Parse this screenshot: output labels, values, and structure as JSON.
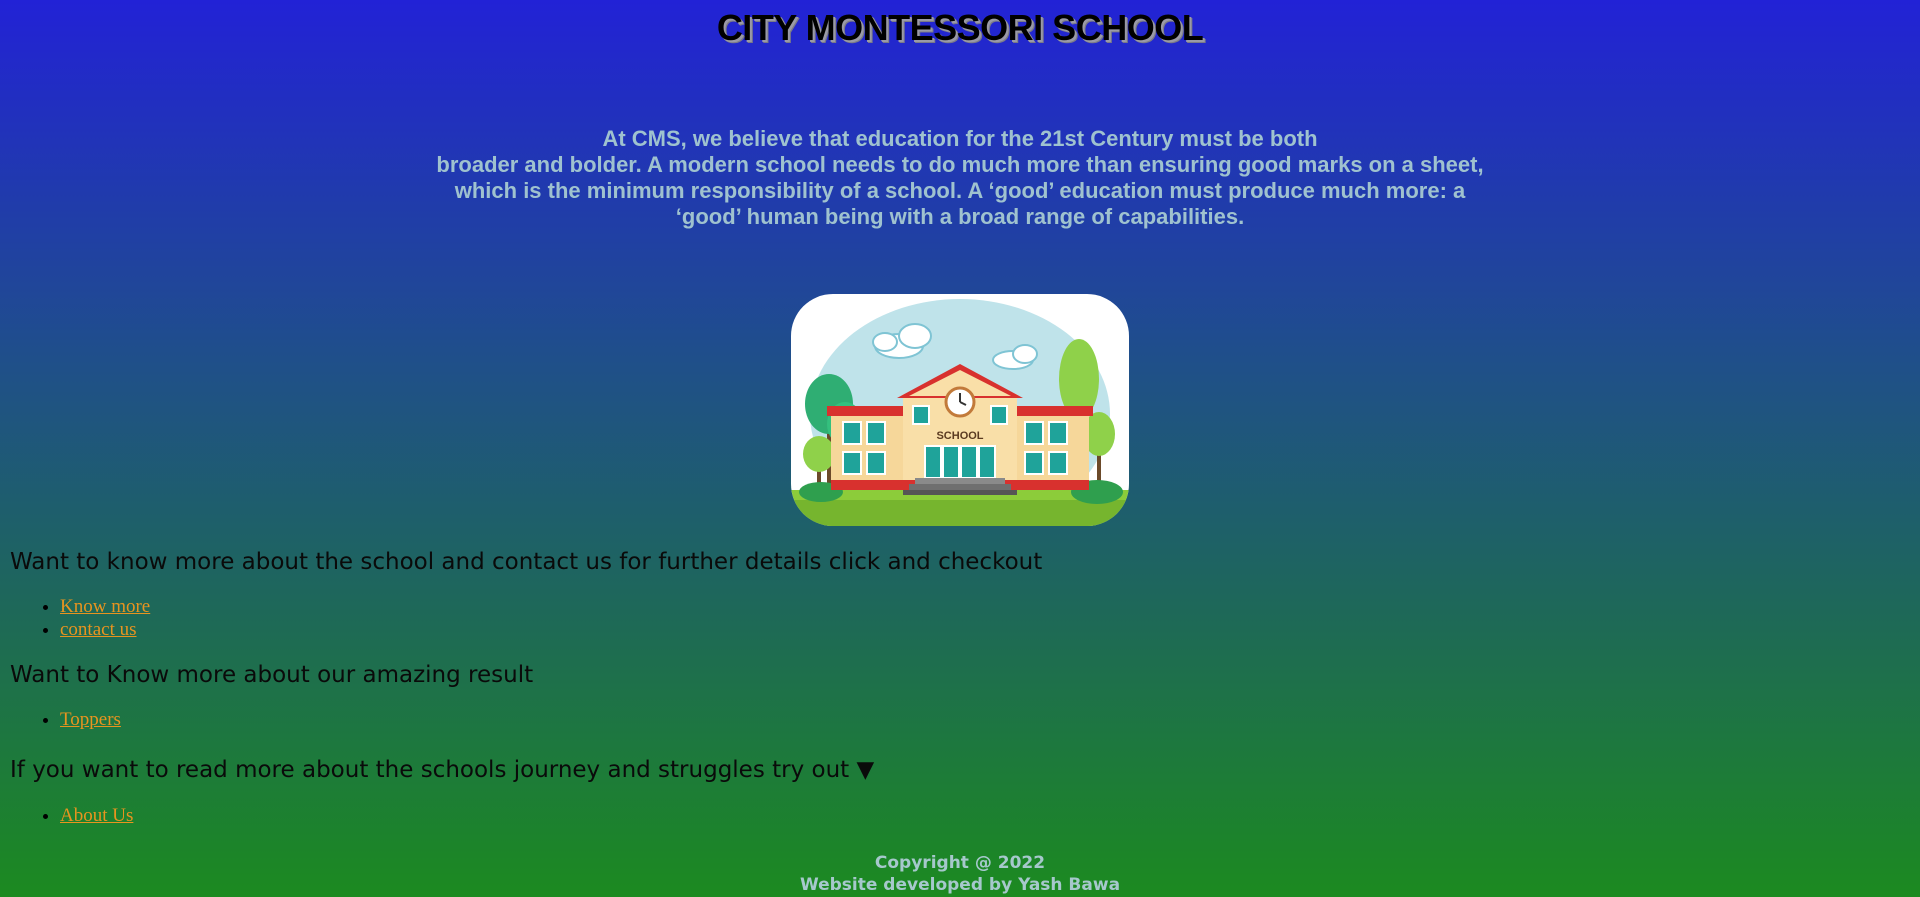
{
  "header": {
    "title": "CITY MONTESSORI SCHOOL"
  },
  "intro": {
    "lines": [
      "At CMS, we believe that education for the 21st Century must be both",
      "broader and bolder. A modern school needs to do much more than ensuring good marks on a sheet,",
      "which is the minimum responsibility of a school. A ‘good’ education must produce much more: a",
      "‘good’ human being with a broad range of capabilities."
    ]
  },
  "image": {
    "sign_text": "SCHOOL"
  },
  "sections": [
    {
      "heading": "Want to know more about the school and contact us for further details click and checkout",
      "links": [
        "Know more",
        "contact us"
      ]
    },
    {
      "heading": "Want to Know more about our amazing result",
      "links": [
        "Toppers"
      ]
    },
    {
      "heading": "If you want to read more about the schools journey and struggles try out ▼",
      "links": [
        "About Us"
      ]
    }
  ],
  "footer": {
    "copyright": "Copyright @ 2022",
    "developer": "Website developed by Yash Bawa"
  },
  "colors": {
    "gradient_top": "#2222d6",
    "gradient_bottom": "#1c8a20",
    "link": "#e8941f",
    "intro_text": "#9fc2cf"
  }
}
